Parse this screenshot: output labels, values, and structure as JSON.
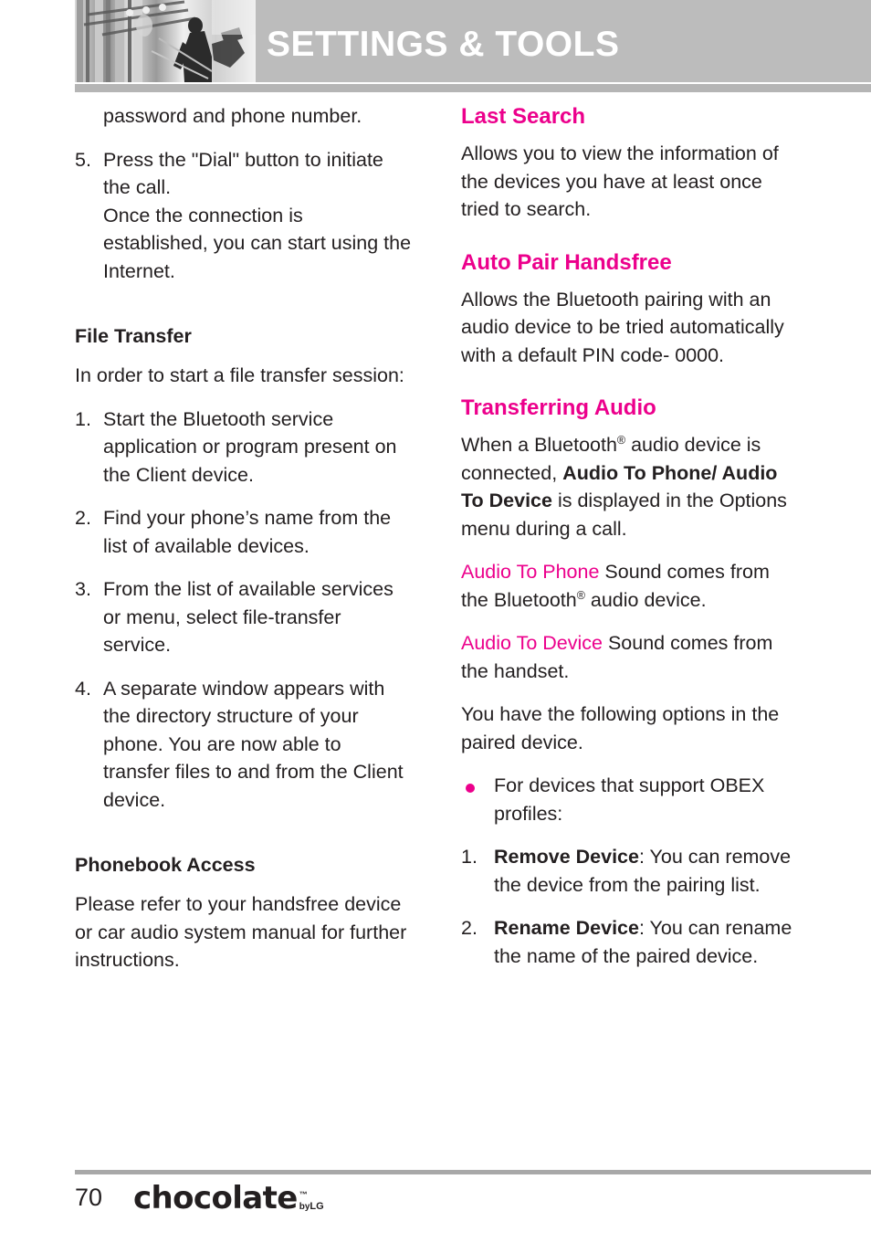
{
  "header": {
    "title": "SETTINGS & TOOLS",
    "photo_alt": "grayscale-photo"
  },
  "left_column": {
    "continued_paragraph": "password and phone number.",
    "step5": {
      "num": "5.",
      "line1": "Press the \"Dial\" button to initiate the call.",
      "line2": "Once the connection is established, you can start using the Internet."
    },
    "file_transfer": {
      "heading": "File Transfer",
      "intro": "In order to start a file transfer session:",
      "steps": [
        {
          "num": "1.",
          "text": "Start the Bluetooth service application or program present on the Client device."
        },
        {
          "num": "2.",
          "text": "Find your phone’s name from the list of available devices."
        },
        {
          "num": "3.",
          "text": "From the list of available services or menu, select file-transfer service."
        },
        {
          "num": "4.",
          "text": "A separate window appears with the directory structure of your phone. You are now able to transfer files to and from the Client device."
        }
      ]
    },
    "phonebook_access": {
      "heading": "Phonebook Access",
      "body": "Please refer to your handsfree device or car audio system manual for further instructions."
    }
  },
  "right_column": {
    "last_search": {
      "heading": "Last Search",
      "body": "Allows you to view the information of the devices you have at least once tried to search."
    },
    "auto_pair": {
      "heading": "Auto Pair Handsfree",
      "body": "Allows the Bluetooth pairing with an audio device to be tried automatically with a default PIN code- 0000."
    },
    "transferring_audio": {
      "heading": "Transferring Audio",
      "intro_part1": "When a Bluetooth",
      "intro_reg": "®",
      "intro_part2": " audio device is connected, ",
      "intro_bold": "Audio To Phone/ Audio To Device",
      "intro_part3": " is displayed in the Options menu during a call.",
      "audio_to_phone": {
        "label": "Audio To Phone",
        "text_part1": "  Sound comes from the Bluetooth",
        "reg": "®",
        "text_part2": " audio device."
      },
      "audio_to_device": {
        "label": "Audio To Device",
        "text": " Sound comes from the handset."
      },
      "options_intro": "You have the following options in the paired device.",
      "bullet": "For devices that support OBEX profiles:",
      "options": [
        {
          "num": "1.",
          "bold": "Remove Device",
          "text": ": You can remove the device from the pairing list."
        },
        {
          "num": "2.",
          "bold": "Rename Device",
          "text": ": You can rename the name of the paired device."
        }
      ]
    }
  },
  "footer": {
    "page_number": "70",
    "logo_word": "chocolate",
    "logo_tm": "™",
    "logo_by": "by",
    "logo_lg": "LG"
  },
  "colors": {
    "accent_pink": "#ec008c",
    "header_gray": "#bcbcbc",
    "rule_gray": "#b5b5b5",
    "text": "#231f20"
  }
}
